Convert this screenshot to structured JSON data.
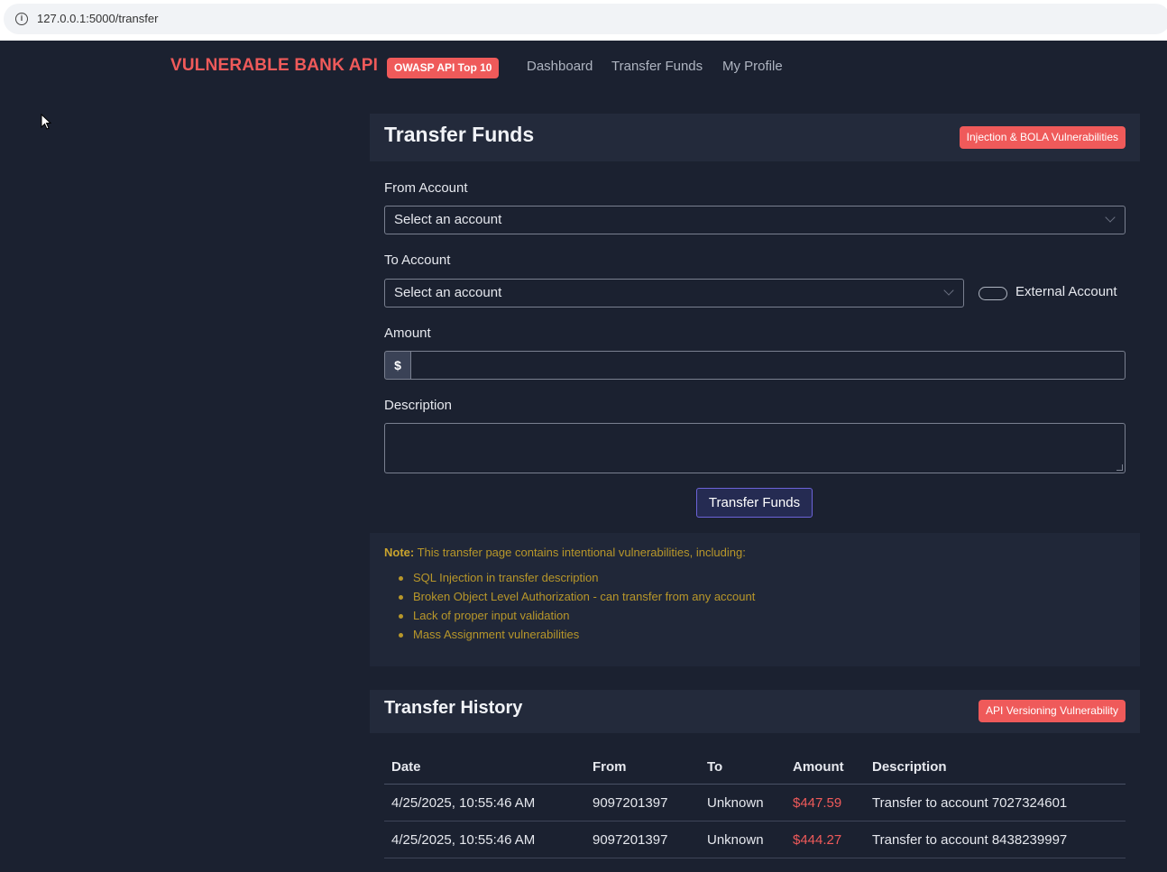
{
  "browser": {
    "url": "127.0.0.1:5000/transfer",
    "info_icon": "info-icon"
  },
  "nav": {
    "brand": "VULNERABLE BANK API",
    "badge": "OWASP API Top 10",
    "links": [
      "Dashboard",
      "Transfer Funds",
      "My Profile"
    ]
  },
  "transfer": {
    "title": "Transfer Funds",
    "badge": "Injection & BOLA Vulnerabilities",
    "from_label": "From Account",
    "from_value": "Select an account",
    "to_label": "To Account",
    "to_value": "Select an account",
    "external_label": "External Account",
    "amount_label": "Amount",
    "currency": "$",
    "amount_value": "",
    "description_label": "Description",
    "description_value": "",
    "submit": "Transfer Funds"
  },
  "note": {
    "prefix": "Note:",
    "text": " This transfer page contains intentional vulnerabilities, including:",
    "items": [
      "SQL Injection in transfer description",
      "Broken Object Level Authorization - can transfer from any account",
      "Lack of proper input validation",
      "Mass Assignment vulnerabilities"
    ]
  },
  "history": {
    "title": "Transfer History",
    "badge": "API Versioning Vulnerability",
    "columns": [
      "Date",
      "From",
      "To",
      "Amount",
      "Description"
    ],
    "rows": [
      [
        "4/25/2025, 10:55:46 AM",
        "9097201397",
        "Unknown",
        "$447.59",
        "Transfer to account 7027324601"
      ],
      [
        "4/25/2025, 10:55:46 AM",
        "9097201397",
        "Unknown",
        "$444.27",
        "Transfer to account 8438239997"
      ]
    ]
  },
  "colors": {
    "background": "#1b2130",
    "accent": "#ef5a5a",
    "note": "#b8972a",
    "button_border": "#6c63d8"
  }
}
